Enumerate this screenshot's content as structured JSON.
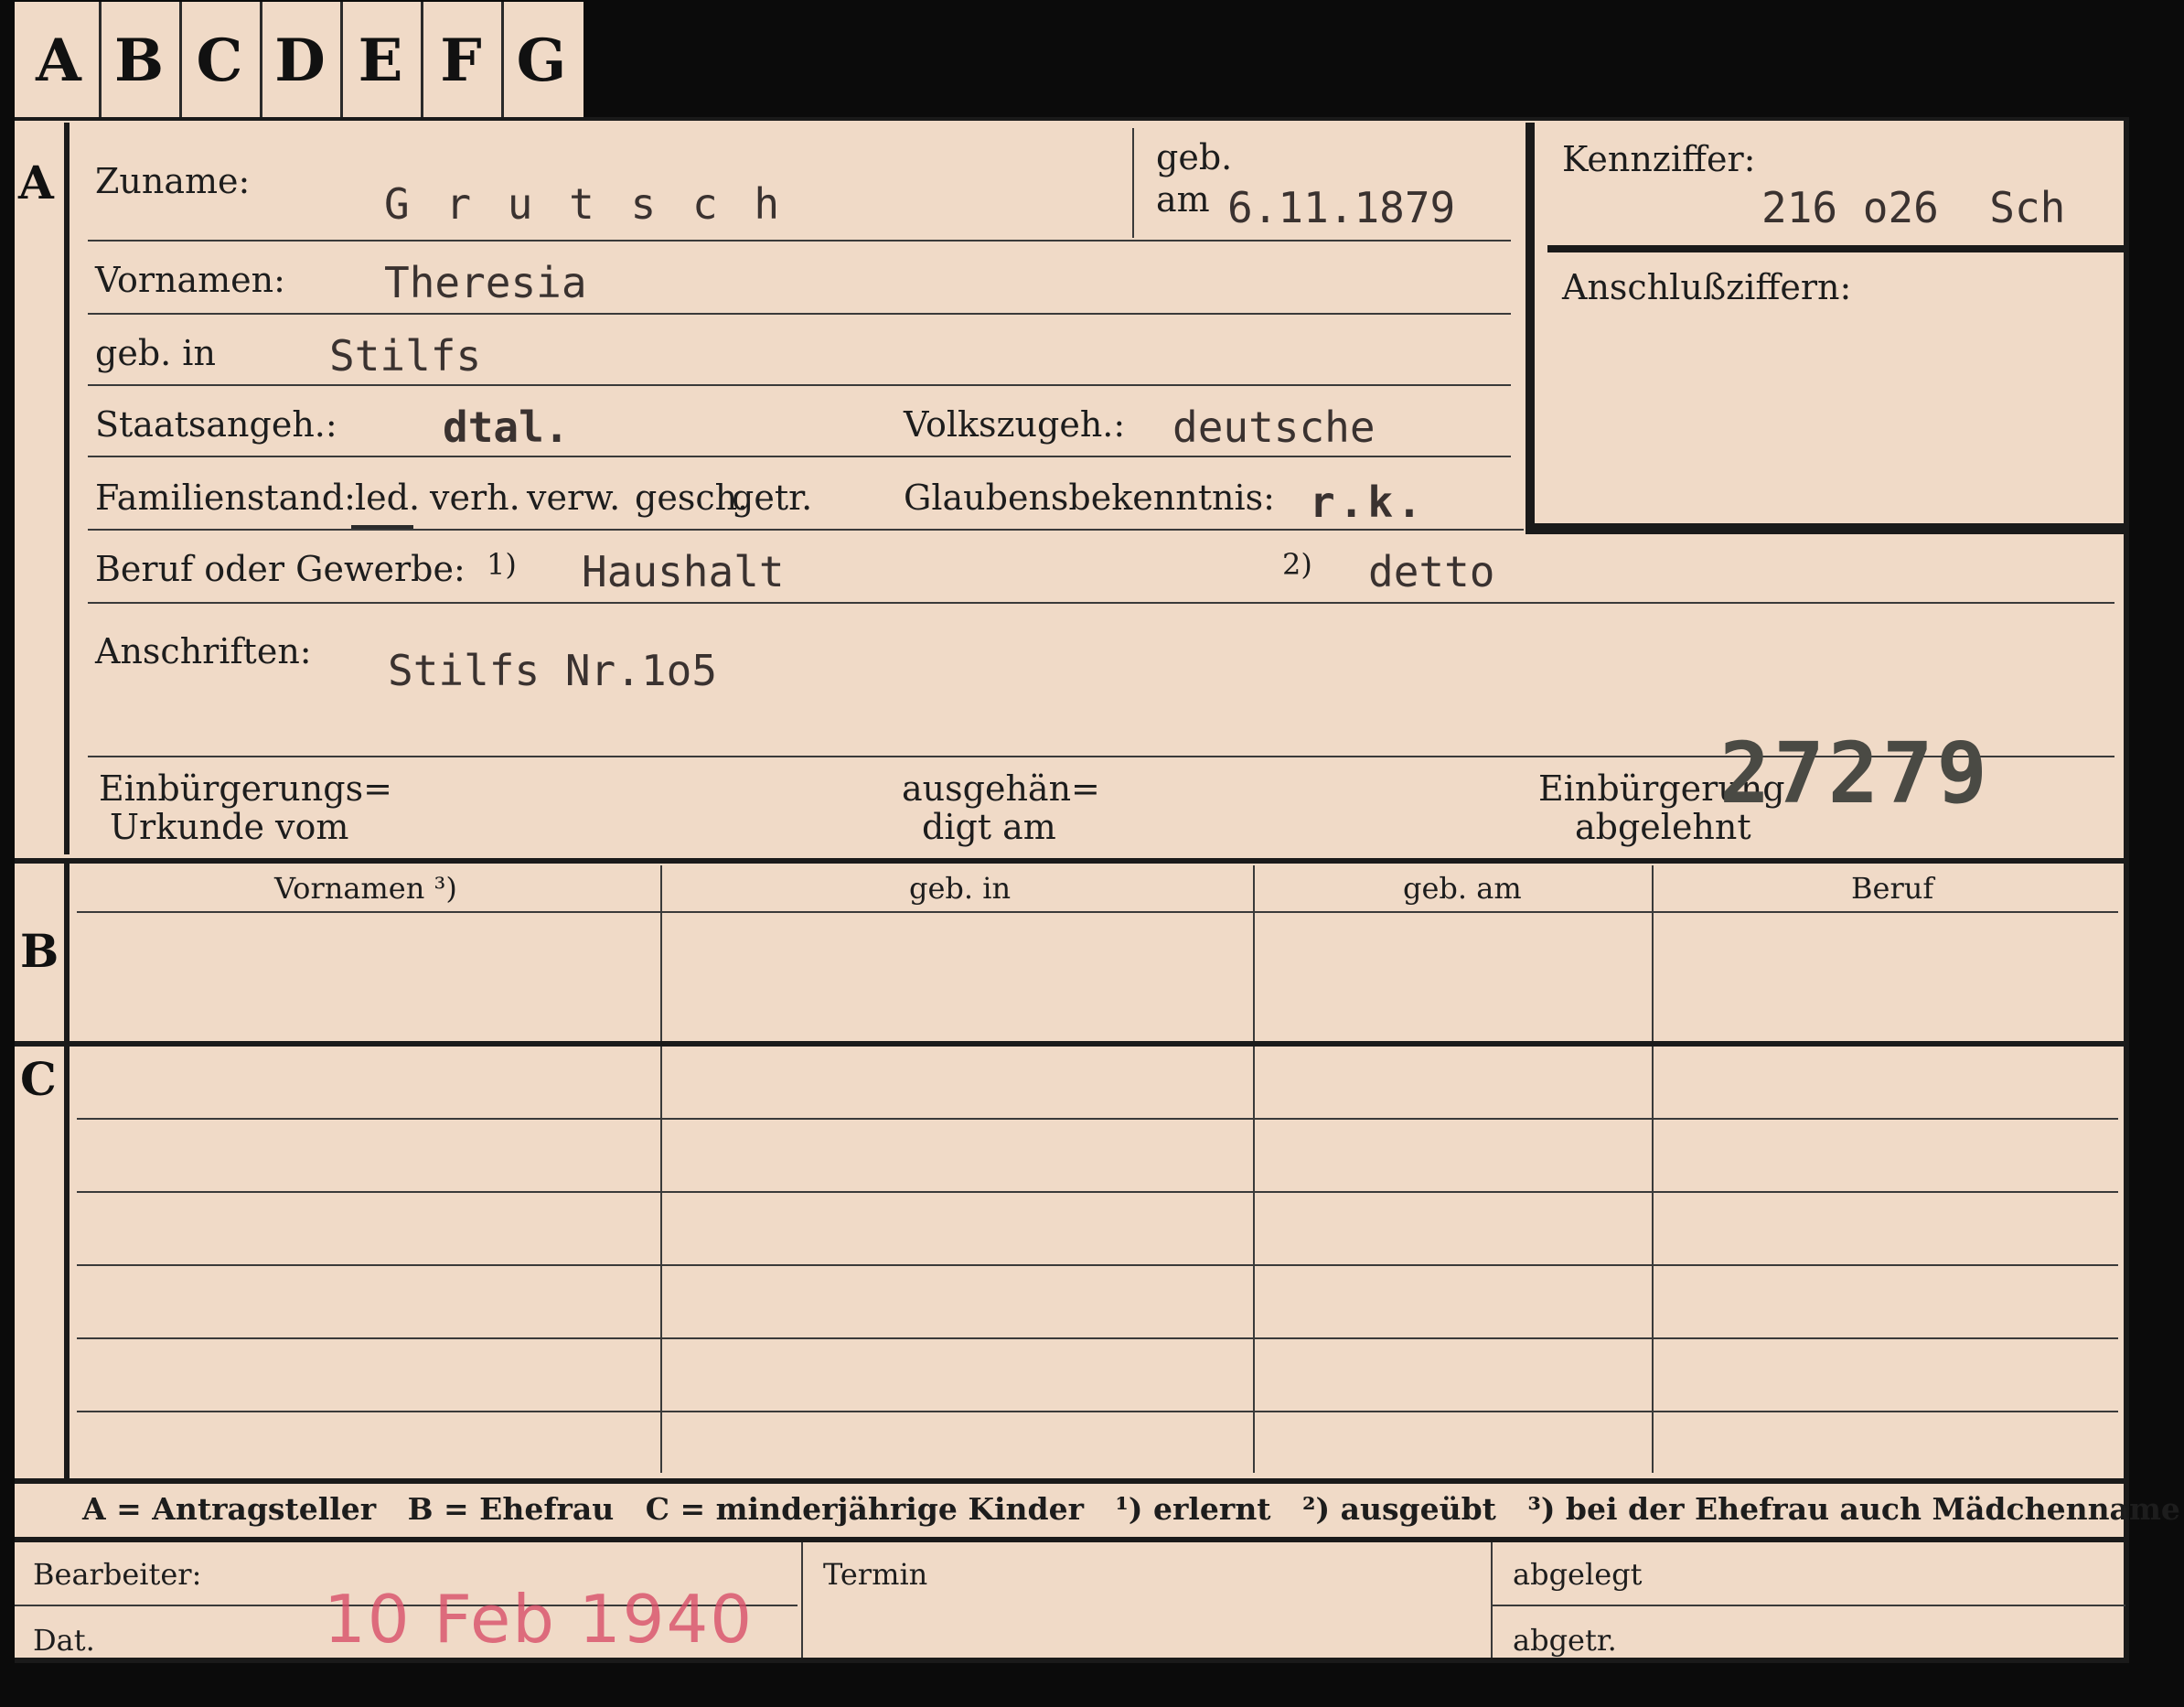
{
  "tabs": [
    "A",
    "B",
    "C",
    "D",
    "E",
    "F",
    "G"
  ],
  "sections": {
    "a": "A",
    "b": "B",
    "c": "C"
  },
  "labels": {
    "zuname": "Zuname:",
    "geb": "geb.",
    "am": "am",
    "kennziffer": "Kennziffer:",
    "anschlussziffern": "Anschlußziffern:",
    "vornamen": "Vornamen:",
    "geb_in": "geb. in",
    "staatsangeh": "Staatsangeh.:",
    "volkszugeh": "Volkszugeh.:",
    "familienstand": "Familienstand:",
    "familienstand_options": [
      "led.",
      "verh.",
      "verw.",
      "gesch.",
      "getr."
    ],
    "glaubensbekenntnis": "Glaubensbekenntnis:",
    "beruf": "Beruf oder Gewerbe:",
    "note1": "1)",
    "note2": "2)",
    "anschriften": "Anschriften:",
    "einbuergerung_urkunde_1": "Einbürgerungs=",
    "einbuergerung_urkunde_2": "Urkunde vom",
    "ausgehaendigt_1": "ausgehän=",
    "ausgehaendigt_2": "digt am",
    "einbuergerung_abgelehnt_1": "Einbürgerung",
    "einbuergerung_abgelehnt_2": "abgelehnt"
  },
  "values": {
    "zuname": "G r u t s c h",
    "geb_am": "6.11.1879",
    "kennziffer": "216 o26  Sch",
    "vornamen": "Theresia",
    "geb_in": "Stilfs",
    "staatsangeh": "dtal.",
    "volkszugeh": "deutsche",
    "glaubensbekenntnis": "r.k.",
    "beruf_erlernt": "Haushalt",
    "beruf_ausgeuebt": "detto",
    "anschrift": "Stilfs Nr.1o5",
    "stamped_number": "27279"
  },
  "table": {
    "headers": [
      "Vornamen ³)",
      "geb. in",
      "geb. am",
      "Beruf"
    ]
  },
  "legend": "A = Antragsteller   B = Ehefrau   C = minderjährige Kinder   ¹) erlernt   ²) ausgeübt   ³) bei der Ehefrau auch Mädchenname",
  "footer": {
    "bearbeiter": "Bearbeiter:",
    "dat": "Dat.",
    "date_stamp": "10 Feb 1940",
    "termin": "Termin",
    "abgelegt": "abgelegt",
    "abgetr": "abgetr."
  }
}
